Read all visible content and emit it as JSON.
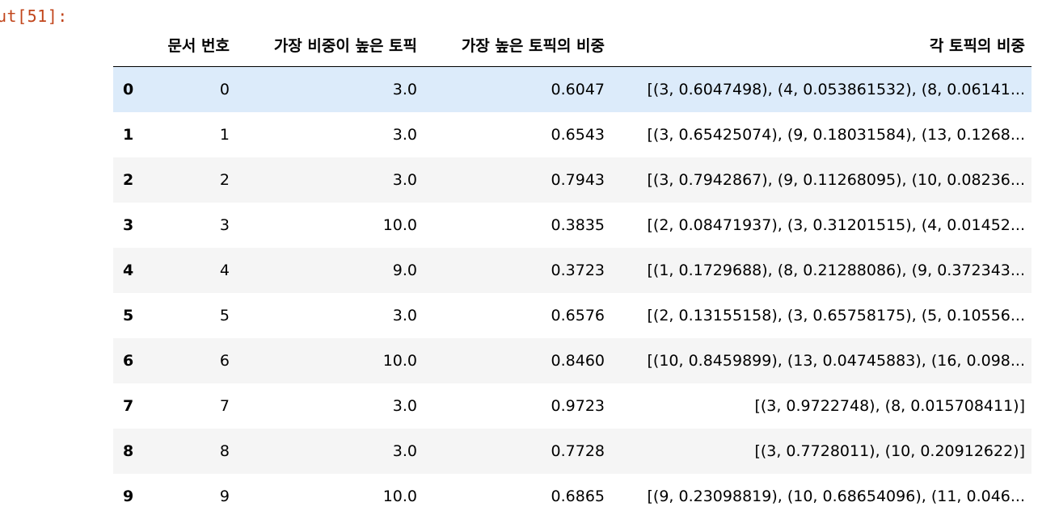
{
  "cell_prompt": "ut[51]:",
  "columns": [
    "",
    "문서 번호",
    "가장 비중이 높은 토픽",
    "가장 높은 토픽의 비중",
    "각 토픽의 비중"
  ],
  "rows": [
    {
      "idx": "0",
      "doc": "0",
      "top": "3.0",
      "weight": "0.6047",
      "dist": "[(3, 0.6047498), (4, 0.053861532), (8, 0.06141..."
    },
    {
      "idx": "1",
      "doc": "1",
      "top": "3.0",
      "weight": "0.6543",
      "dist": "[(3, 0.65425074), (9, 0.18031584), (13, 0.1268..."
    },
    {
      "idx": "2",
      "doc": "2",
      "top": "3.0",
      "weight": "0.7943",
      "dist": "[(3, 0.7942867), (9, 0.11268095), (10, 0.08236..."
    },
    {
      "idx": "3",
      "doc": "3",
      "top": "10.0",
      "weight": "0.3835",
      "dist": "[(2, 0.08471937), (3, 0.31201515), (4, 0.01452..."
    },
    {
      "idx": "4",
      "doc": "4",
      "top": "9.0",
      "weight": "0.3723",
      "dist": "[(1, 0.1729688), (8, 0.21288086), (9, 0.372343..."
    },
    {
      "idx": "5",
      "doc": "5",
      "top": "3.0",
      "weight": "0.6576",
      "dist": "[(2, 0.13155158), (3, 0.65758175), (5, 0.10556..."
    },
    {
      "idx": "6",
      "doc": "6",
      "top": "10.0",
      "weight": "0.8460",
      "dist": "[(10, 0.8459899), (13, 0.04745883), (16, 0.098..."
    },
    {
      "idx": "7",
      "doc": "7",
      "top": "3.0",
      "weight": "0.9723",
      "dist": "[(3, 0.9722748), (8, 0.015708411)]"
    },
    {
      "idx": "8",
      "doc": "8",
      "top": "3.0",
      "weight": "0.7728",
      "dist": "[(3, 0.7728011), (10, 0.20912622)]"
    },
    {
      "idx": "9",
      "doc": "9",
      "top": "10.0",
      "weight": "0.6865",
      "dist": "[(9, 0.23098819), (10, 0.68654096), (11, 0.046..."
    }
  ],
  "colors": {
    "prompt": "#c1451b",
    "row_hover": "#dcebfa",
    "row_odd": "#f5f5f5"
  }
}
